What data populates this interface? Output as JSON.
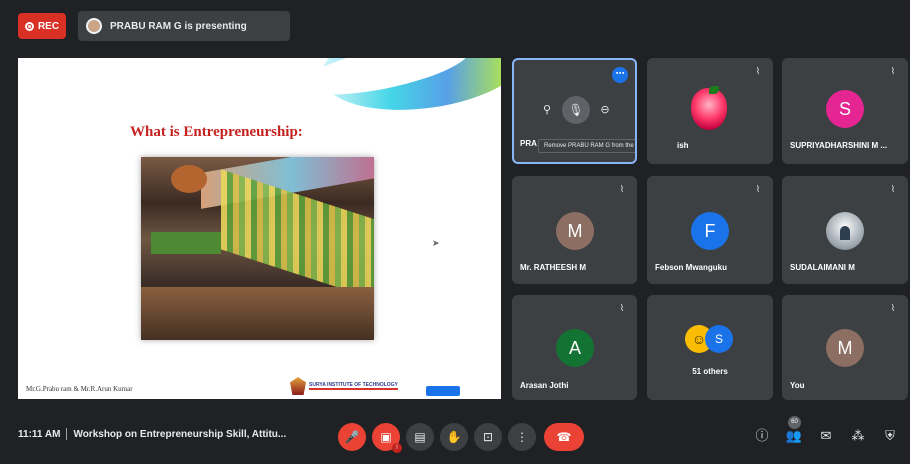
{
  "topbar": {
    "rec_label": "REC",
    "presenting_text": "PRABU RAM G is presenting"
  },
  "slide": {
    "title": "What is Entrepreneurship:",
    "footer": "Mr.G.Prabu ram  & Mr.R.Arun Kumar",
    "logo_text": "SURYA INSTITUTE OF TECHNOLOGY"
  },
  "tiles": [
    {
      "name": "PRA",
      "tooltip": "Remove PRABU RAM G from the call"
    },
    {
      "name": "ish"
    },
    {
      "name": "SUPRIYADHARSHINI M ...",
      "initial": "S",
      "color": "#e52592"
    },
    {
      "name": "Mr. RATHEESH M",
      "initial": "M",
      "color": "#8d6e63"
    },
    {
      "name": "Febson Mwanguku",
      "initial": "F",
      "color": "#1a73e8"
    },
    {
      "name": "SUDALAIMANI M"
    },
    {
      "name": "Arasan Jothi",
      "initial": "A",
      "color": "#137333"
    },
    {
      "name": "51 others",
      "initial": "S",
      "color": "#1a73e8"
    },
    {
      "name": "You",
      "initial": "M",
      "color": "#8d6e63"
    }
  ],
  "bottombar": {
    "time": "11:11 AM",
    "meeting_title": "Workshop on Entrepreneurship Skill, Attitu...",
    "people_count": "60"
  },
  "icons": {
    "mic_off": "mic-off-icon",
    "camera_off": "videocam-off-icon",
    "captions": "captions-icon",
    "raise_hand": "hand-icon",
    "present": "present-icon",
    "more": "more-vert-icon",
    "hangup": "call-end-icon",
    "info": "info-icon",
    "people": "people-icon",
    "chat": "chat-icon",
    "activities": "activities-icon",
    "host_controls": "shield-icon"
  }
}
